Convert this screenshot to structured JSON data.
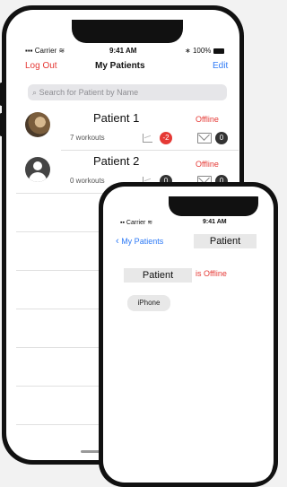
{
  "status": {
    "carrier": "Carrier",
    "time": "9:41 AM",
    "battery": "100%"
  },
  "nav": {
    "left": "Log Out",
    "title": "My Patients",
    "right": "Edit"
  },
  "search": {
    "placeholder": "Search for Patient by Name"
  },
  "patients": [
    {
      "name": "Patient 1",
      "workouts": "7 workouts",
      "status": "Offline",
      "chart_badge": "-2",
      "mail_badge": "0"
    },
    {
      "name": "Patient 2",
      "workouts": "0 workouts",
      "status": "Offline",
      "chart_badge": "0",
      "mail_badge": "0"
    }
  ],
  "detail": {
    "status": {
      "carrier": "Carrier",
      "time": "9:41 AM"
    },
    "back": "My Patients",
    "title": "Patient",
    "patient_label": "Patient",
    "offline_text": "is Offline",
    "device": "iPhone"
  },
  "colors": {
    "accent_red": "#e53935",
    "accent_blue": "#2f7bf6"
  }
}
